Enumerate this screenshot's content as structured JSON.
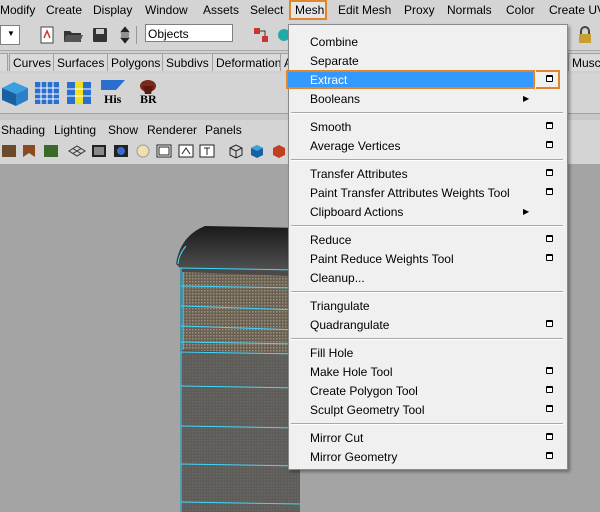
{
  "menubar": {
    "items": [
      "Modify",
      "Create",
      "Display",
      "Window",
      "Assets",
      "Select",
      "Mesh",
      "Edit Mesh",
      "Proxy",
      "Normals",
      "Color",
      "Create UV"
    ]
  },
  "statusbar": {
    "objects_field": "Objects"
  },
  "shelf": {
    "tabs": [
      "Curves",
      "Surfaces",
      "Polygons",
      "Subdivs",
      "Deformation",
      "A",
      "Musc"
    ],
    "icons": [
      "His",
      "BR"
    ]
  },
  "panel_menu": {
    "items": [
      "Shading",
      "Lighting",
      "Show",
      "Renderer",
      "Panels"
    ]
  },
  "mesh_menu": {
    "items": [
      {
        "label": "Combine",
        "option": false,
        "submenu": false
      },
      {
        "label": "Separate",
        "option": false,
        "submenu": false
      },
      {
        "label": "Extract",
        "option": true,
        "submenu": false,
        "highlighted": true
      },
      {
        "label": "Booleans",
        "option": false,
        "submenu": true
      },
      {
        "label": "Smooth",
        "option": true,
        "submenu": false
      },
      {
        "label": "Average Vertices",
        "option": true,
        "submenu": false
      },
      {
        "label": "Transfer Attributes",
        "option": true,
        "submenu": false
      },
      {
        "label": "Paint Transfer Attributes Weights Tool",
        "option": true,
        "submenu": false
      },
      {
        "label": "Clipboard Actions",
        "option": false,
        "submenu": true
      },
      {
        "label": "Reduce",
        "option": true,
        "submenu": false
      },
      {
        "label": "Paint Reduce Weights Tool",
        "option": true,
        "submenu": false
      },
      {
        "label": "Cleanup...",
        "option": false,
        "submenu": false
      },
      {
        "label": "Triangulate",
        "option": false,
        "submenu": false
      },
      {
        "label": "Quadrangulate",
        "option": true,
        "submenu": false
      },
      {
        "label": "Fill Hole",
        "option": false,
        "submenu": false
      },
      {
        "label": "Make Hole Tool",
        "option": true,
        "submenu": false
      },
      {
        "label": "Create Polygon Tool",
        "option": true,
        "submenu": false
      },
      {
        "label": "Sculpt Geometry Tool",
        "option": true,
        "submenu": false
      },
      {
        "label": "Mirror Cut",
        "option": true,
        "submenu": false
      },
      {
        "label": "Mirror Geometry",
        "option": true,
        "submenu": false
      }
    ]
  },
  "colors": {
    "highlight": "#3399ff",
    "annotation": "#e0862c",
    "wireframe": "#40d8ff"
  }
}
